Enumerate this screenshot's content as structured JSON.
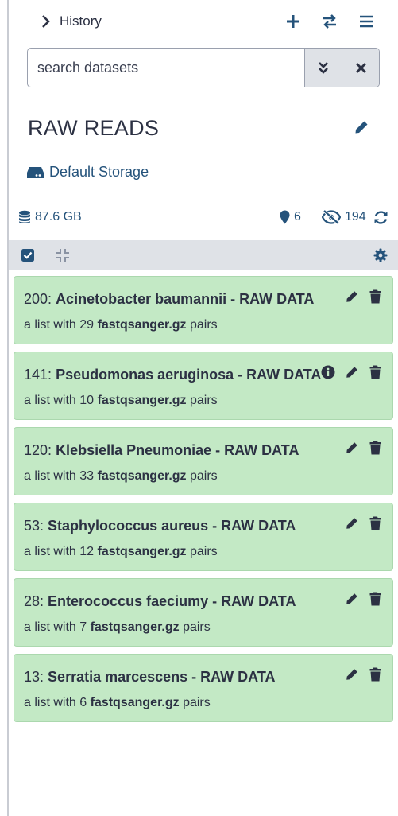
{
  "history_toggle": {
    "label": "History"
  },
  "search": {
    "placeholder": "search datasets"
  },
  "history": {
    "name": "RAW READS",
    "storage_label": "Default Storage",
    "size": "87.6 GB",
    "shown_count": "6",
    "hidden_count": "194"
  },
  "colors": {
    "dataset_ok": "#c3e9c5",
    "link": "#25537b",
    "toolbar": "#dfe2e7"
  },
  "datasets": [
    {
      "hid": "200",
      "name": "Acinetobacter baumannii - RAW DATA",
      "desc_pre": "a list with 29",
      "format": "fastqsanger.gz",
      "desc_post": "pairs",
      "info": false
    },
    {
      "hid": "141",
      "name": "Pseudomonas aeruginosa - RAW DATA",
      "desc_pre": "a list with 10",
      "format": "fastqsanger.gz",
      "desc_post": "pairs",
      "info": true
    },
    {
      "hid": "120",
      "name": "Klebsiella Pneumoniae - RAW DATA",
      "desc_pre": "a list with 33",
      "format": "fastqsanger.gz",
      "desc_post": "pairs",
      "info": false
    },
    {
      "hid": "53",
      "name": "Staphylococcus aureus - RAW DATA",
      "desc_pre": "a list with 12",
      "format": "fastqsanger.gz",
      "desc_post": "pairs",
      "info": false
    },
    {
      "hid": "28",
      "name": "Enterococcus faeciumy - RAW DATA",
      "desc_pre": "a list with 7",
      "format": "fastqsanger.gz",
      "desc_post": "pairs",
      "info": false
    },
    {
      "hid": "13",
      "name": "Serratia marcescens - RAW DATA",
      "desc_pre": "a list with 6",
      "format": "fastqsanger.gz",
      "desc_post": "pairs",
      "info": false
    }
  ]
}
